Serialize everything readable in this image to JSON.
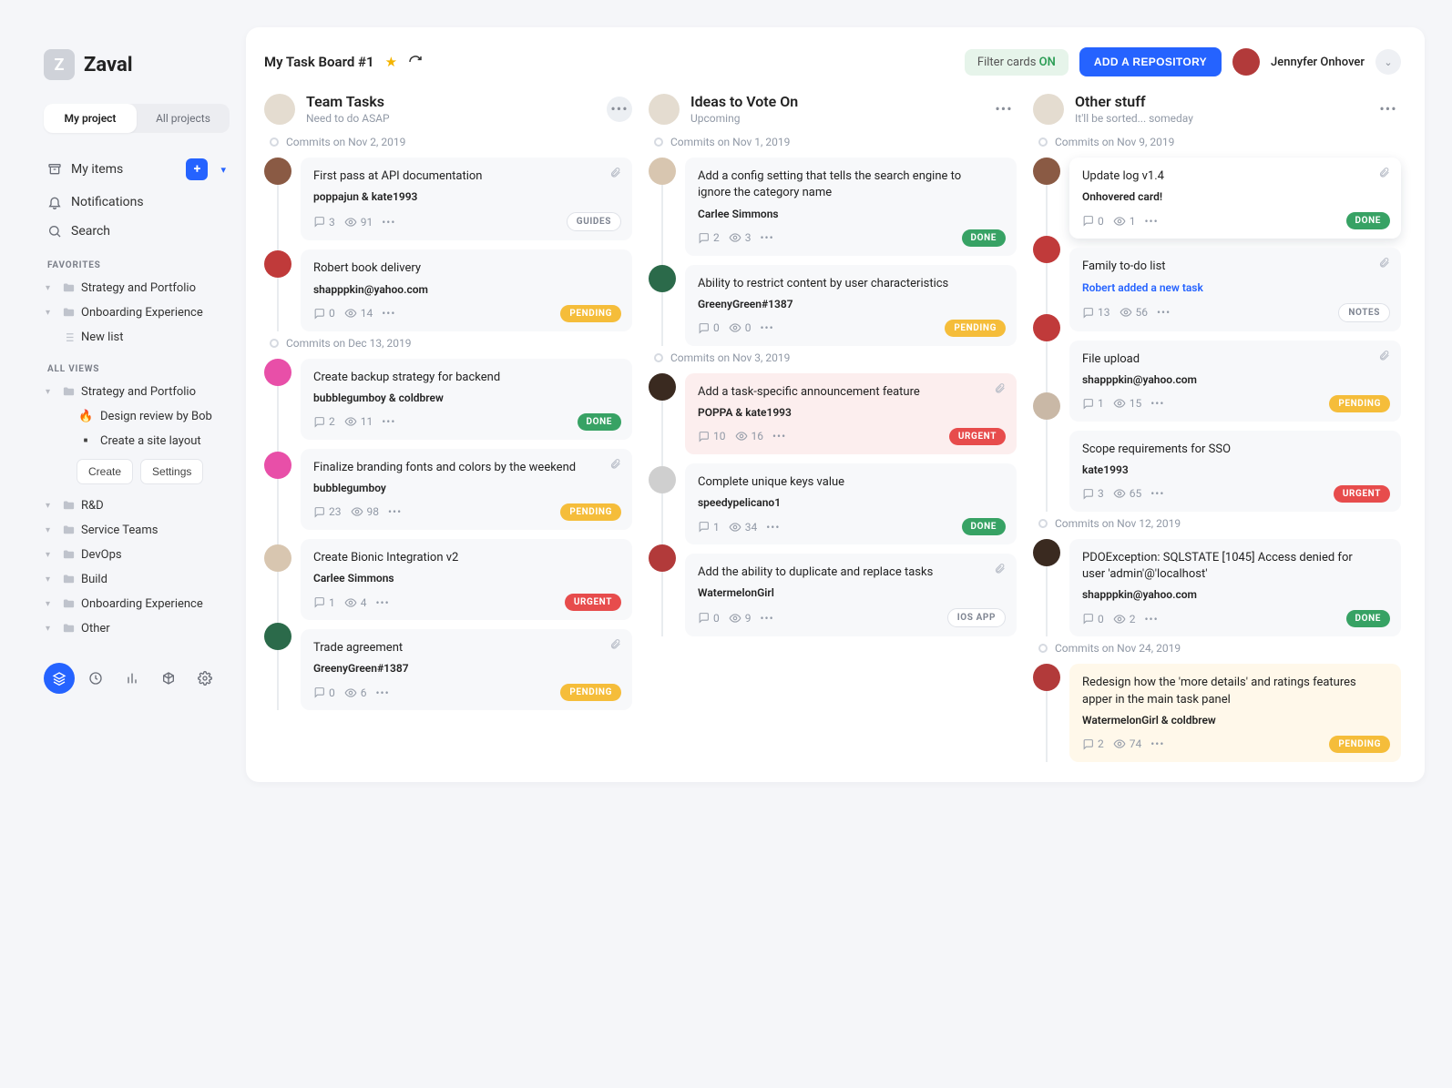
{
  "brand": "Zaval",
  "projectTabs": {
    "my": "My project",
    "all": "All projects"
  },
  "nav": {
    "items": "My items",
    "notifications": "Notifications",
    "search": "Search"
  },
  "favorites": {
    "label": "FAVORITES",
    "items": [
      "Strategy and Portfolio",
      "Onboarding Experience",
      "New list"
    ]
  },
  "allViews": {
    "label": "ALL VIEWS",
    "head": "Strategy and Portfolio",
    "sub1": "Design review by Bob",
    "sub2": "Create a site layout",
    "createBtn": "Create",
    "settingsBtn": "Settings",
    "rest": [
      "R&D",
      "Service Teams",
      "DevOps",
      "Build",
      "Onboarding Experience",
      "Other"
    ]
  },
  "topbar": {
    "title": "My Task Board #1",
    "filterLabel": "Filter cards ",
    "filterState": "ON",
    "addRepo": "ADD A REPOSITORY",
    "user": "Jennyfer Onhover"
  },
  "columns": [
    {
      "title": "Team Tasks",
      "sub": "Need to do ASAP",
      "groups": [
        {
          "label": "Commits on Nov 2, 2019",
          "cards": [
            {
              "title": "First pass at API documentation",
              "author": "poppajun & kate1993",
              "c": 3,
              "v": 91,
              "pill": "GUIDES",
              "pillType": "outline",
              "clip": true,
              "av": "#8a5a44"
            },
            {
              "title": "Robert book delivery",
              "author": "shapppkin@yahoo.com",
              "c": 0,
              "v": 14,
              "pill": "PENDING",
              "pillType": "pending",
              "av": "#c03a3a"
            }
          ]
        },
        {
          "label": "Commits on Dec 13, 2019",
          "cards": [
            {
              "title": "Create backup strategy for backend",
              "author": "bubblegumboy & coldbrew",
              "c": 2,
              "v": 11,
              "pill": "DONE",
              "pillType": "done",
              "av": "#e84fa8"
            },
            {
              "title": "Finalize branding fonts and colors by the weekend",
              "author": "bubblegumboy",
              "c": 23,
              "v": 98,
              "pill": "PENDING",
              "pillType": "pending",
              "clip": true,
              "av": "#e84fa8"
            },
            {
              "title": "Create Bionic Integration v2",
              "author": "Carlee Simmons",
              "c": 1,
              "v": 4,
              "pill": "URGENT",
              "pillType": "urgent",
              "av": "#d8c6b0"
            },
            {
              "title": "Trade agreement",
              "author": "GreenyGreen#1387",
              "c": 0,
              "v": 6,
              "pill": "PENDING",
              "pillType": "pending",
              "clip": true,
              "av": "#2b6a4a"
            }
          ]
        }
      ]
    },
    {
      "title": "Ideas to Vote On",
      "sub": "Upcoming",
      "groups": [
        {
          "label": "Commits on Nov 1, 2019",
          "cards": [
            {
              "title": "Add a config setting that tells the search engine to ignore the category name",
              "author": "Carlee Simmons",
              "c": 2,
              "v": 3,
              "pill": "DONE",
              "pillType": "done",
              "av": "#d8c6b0"
            },
            {
              "title": "Ability to restrict content by user characteristics",
              "author": "GreenyGreen#1387",
              "c": 0,
              "v": 0,
              "pill": "PENDING",
              "pillType": "pending",
              "av": "#2b6a4a"
            }
          ]
        },
        {
          "label": "Commits on Nov 3, 2019",
          "cards": [
            {
              "title": "Add a task-specific announcement feature",
              "author": "POPPA & kate1993",
              "c": 10,
              "v": 16,
              "pill": "URGENT",
              "pillType": "urgent",
              "variant": "red",
              "clip": true,
              "av": "#3a2a20"
            },
            {
              "title": "Complete unique keys value",
              "author": "speedypelicano1",
              "c": 1,
              "v": 34,
              "pill": "DONE",
              "pillType": "done",
              "av": "#cfcfcf"
            },
            {
              "title": "Add the ability to duplicate and replace tasks",
              "author": "WatermelonGirl",
              "c": 0,
              "v": 9,
              "pill": "IOS APP",
              "pillType": "outline",
              "clip": true,
              "av": "#b23a3a"
            }
          ]
        }
      ]
    },
    {
      "title": "Other stuff",
      "sub": "It'll be sorted... someday",
      "groups": [
        {
          "label": "Commits on Nov 9, 2019",
          "cards": [
            {
              "title": "Update log v1.4",
              "author": "Onhovered card!",
              "c": 0,
              "v": 1,
              "pill": "DONE",
              "pillType": "done",
              "variant": "hl",
              "clip": true,
              "av": "#8a5a44"
            },
            {
              "title": "Family to-do list",
              "author": "Robert added a new task",
              "authorLink": true,
              "c": 13,
              "v": 56,
              "pill": "NOTES",
              "pillType": "outline",
              "clip": true,
              "av": "#c03a3a"
            },
            {
              "title": "File upload",
              "author": "shapppkin@yahoo.com",
              "c": 1,
              "v": 15,
              "pill": "PENDING",
              "pillType": "pending",
              "clip": true,
              "av": "#c03a3a"
            },
            {
              "title": "Scope requirements for SSO",
              "author": "kate1993",
              "c": 3,
              "v": 65,
              "pill": "URGENT",
              "pillType": "urgent",
              "av": "#c9b8a6"
            }
          ]
        },
        {
          "label": "Commits on Nov 12, 2019",
          "cards": [
            {
              "title": "PDOException: SQLSTATE [1045] Access denied for user 'admin'@'localhost'",
              "author": "shapppkin@yahoo.com",
              "c": 0,
              "v": 2,
              "pill": "DONE",
              "pillType": "done",
              "av": "#3a2a20"
            }
          ]
        },
        {
          "label": "Commits on Nov 24, 2019",
          "cards": [
            {
              "title": "Redesign how the 'more details' and ratings features apper in the main task panel",
              "author": "WatermelonGirl & coldbrew",
              "c": 2,
              "v": 74,
              "pill": "PENDING",
              "pillType": "pending",
              "variant": "yellow",
              "av": "#b23a3a"
            }
          ]
        }
      ]
    }
  ]
}
